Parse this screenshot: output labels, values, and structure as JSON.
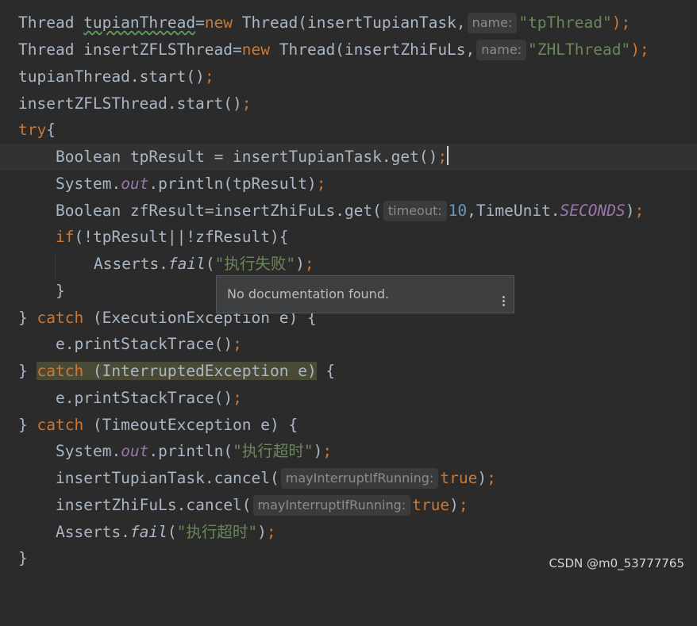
{
  "code": {
    "l1": {
      "a": "Thread ",
      "b": "tupianThread",
      "c": "=",
      "d": "new",
      "e": " Thread(insertTupianTask,",
      "hint": "name:",
      "str": "\"tpThread\"",
      "f": ");"
    },
    "l2": {
      "a": "Thread insertZFLSThread=",
      "d": "new",
      "e": " Thread(insertZhiFuLs,",
      "hint": "name:",
      "str": "\"ZHLThread\"",
      "f": ");"
    },
    "l3": {
      "a": "tupianThread.start()",
      "f": ";"
    },
    "l4": {
      "a": "insertZFLSThread.start()",
      "f": ";"
    },
    "l5": {
      "d": "try",
      "a": "{"
    },
    "l6": {
      "a": "Boolean tpResult = insertTupianTask.get()",
      "f": ";"
    },
    "l7": {
      "a": "System.",
      "fld": "out",
      "b": ".println(tpResult)",
      "f": ";"
    },
    "l8": {
      "a": "Boolean zfResult=insertZhiFuLs.get(",
      "hint": "timeout:",
      "num": "10",
      "b": ",TimeUnit.",
      "fld": "SECONDS",
      "c": ")",
      "f": ";"
    },
    "l9": {
      "d": "if",
      "a": "(!tpResult||!zfResult){"
    },
    "l10": {
      "a": "Asserts.",
      "it": "fail",
      "b": "(",
      "str": "\"执行失败\"",
      "c": ")",
      "f": ";"
    },
    "l11": {
      "a": "}"
    },
    "l12": {
      "a": "} ",
      "d": "catch",
      "b": " (ExecutionException e) {"
    },
    "l13": {
      "a": "e.printStackTrace()",
      "f": ";"
    },
    "l14": {
      "a": "} ",
      "d": "catch",
      "b": " (InterruptedException e)",
      "c": " {"
    },
    "l15": {
      "a": "e.printStackTrace()",
      "f": ";"
    },
    "l16": {
      "a": "} ",
      "d": "catch",
      "b": " (TimeoutException e) {"
    },
    "l17": {
      "a": "System.",
      "fld": "out",
      "b": ".println(",
      "str": "\"执行超时\"",
      "c": ")",
      "f": ";"
    },
    "l18": {
      "a": "insertTupianTask.cancel(",
      "hint": "mayInterruptIfRunning:",
      "d": "true",
      "c": ")",
      "f": ";"
    },
    "l19": {
      "a": "insertZhiFuLs.cancel(",
      "hint": "mayInterruptIfRunning:",
      "d": "true",
      "c": ")",
      "f": ";"
    },
    "l20": {
      "a": "Asserts.",
      "it": "fail",
      "b": "(",
      "str": "\"执行超时\"",
      "c": ")",
      "f": ";"
    },
    "l21": {
      "a": "}"
    }
  },
  "tooltip": {
    "text": "No documentation found."
  },
  "watermark": "CSDN @m0_53777765",
  "colors": {
    "background": "#2b2b2b",
    "keyword": "#cc7832",
    "string": "#6a8759",
    "number": "#6897bb",
    "field": "#9876aa",
    "text": "#a9b7c6"
  }
}
